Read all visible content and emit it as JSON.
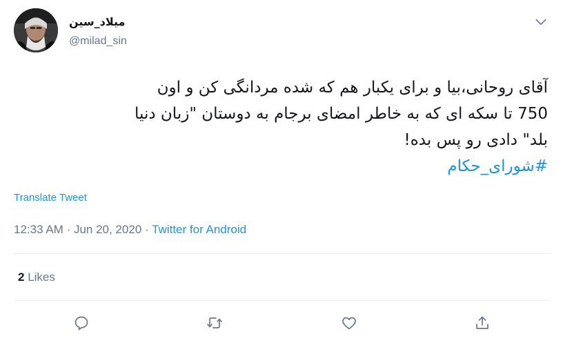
{
  "author": {
    "display_name": "میلاد_سین",
    "handle": "@milad_sin",
    "avatar_icon": "profile-photo"
  },
  "tweet": {
    "lines": [
      "آقای روحانی،بیا و برای یکبار هم که شده مردانگی کن و اون",
      "750 تا سکه ای که به خاطر امضای برجام به دوستان \"زبان دنیا",
      "بلد\" دادی رو پس بده!"
    ],
    "hashtag": "#شورای_حکام"
  },
  "translate_label": "Translate Tweet",
  "meta": {
    "time": "12:33 AM",
    "separator": "·",
    "date": "Jun 20, 2020",
    "source": "Twitter for Android"
  },
  "stats": {
    "likes_count": "2",
    "likes_label": "Likes"
  },
  "actions": {
    "reply_icon": "reply-icon",
    "retweet_icon": "retweet-icon",
    "like_icon": "heart-icon",
    "share_icon": "share-icon"
  },
  "colors": {
    "link": "#1b95e0",
    "secondary_text": "#657786",
    "divider": "#e6ecf0"
  }
}
